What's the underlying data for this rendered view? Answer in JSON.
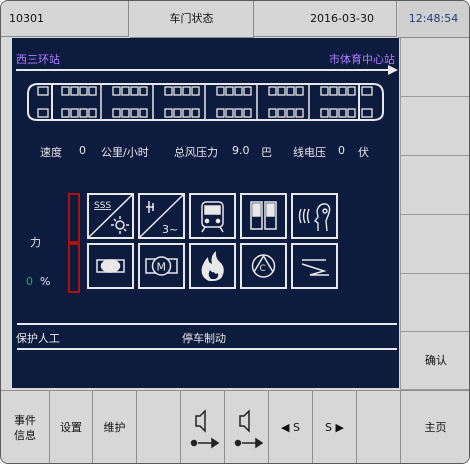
{
  "header": {
    "id": "10301",
    "title": "车门状态",
    "date": "2016-03-30",
    "time": "12:48:54"
  },
  "route": {
    "from_station": "西三环站",
    "to_station": "市体育中心站"
  },
  "readouts": {
    "speed_label": "速度",
    "speed_value": "0",
    "speed_unit": "公里/小时",
    "pressure_label": "总风压力",
    "pressure_value": "9.0",
    "pressure_unit": "巴",
    "voltage_label": "线电压",
    "voltage_value": "0",
    "voltage_unit": "伏"
  },
  "force": {
    "label": "力",
    "value": "0",
    "unit": "%"
  },
  "icon_text": {
    "sss": "SSS",
    "three_phase": "3~"
  },
  "status": {
    "left": "保护人工",
    "center": "停车制动"
  },
  "side_menu": {
    "confirm": "确认"
  },
  "bottom_menu": {
    "events": "事件\n信息",
    "settings": "设置",
    "maintenance": "维护",
    "s_left": "◀ S",
    "s_right": "S ▶",
    "home": "主页"
  },
  "colors": {
    "screen": "#0c1b3e",
    "station": "#b07cff",
    "gauge_border": "#b01010",
    "force_value": "#2aa84a",
    "time": "#1f3f7a"
  }
}
